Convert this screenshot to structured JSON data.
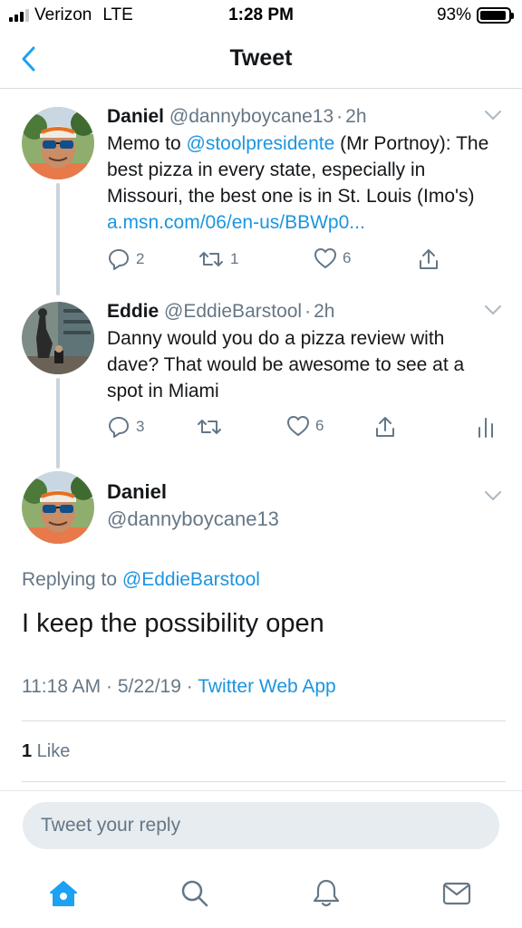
{
  "status_bar": {
    "carrier": "Verizon",
    "network": "LTE",
    "time": "1:28 PM",
    "battery_percent": "93%",
    "battery_level": 0.93
  },
  "nav": {
    "title": "Tweet",
    "back_icon": "chevron-left-icon"
  },
  "thread": [
    {
      "name": "Daniel",
      "handle": "@dannyboycane13",
      "dot": "·",
      "time": "2h",
      "text_parts": {
        "pre": "Memo to ",
        "mention": "@stoolpresidente",
        "mid": " (Mr Portnoy): The best pizza in every state, especially in Missouri, the best one is in St. Louis (Imo's) ",
        "link": "a.msn.com/06/en-us/BBWp0..."
      },
      "actions": {
        "replies": "2",
        "retweets": "1",
        "likes": "6"
      }
    },
    {
      "name": "Eddie",
      "handle": "@EddieBarstool",
      "dot": "·",
      "time": "2h",
      "text": "Danny would you do a pizza review with dave? That would be awesome to see at a spot in Miami",
      "actions": {
        "replies": "3",
        "retweets": "",
        "likes": "6"
      }
    }
  ],
  "main_tweet": {
    "name": "Daniel",
    "handle": "@dannyboycane13",
    "replying_prefix": "Replying to ",
    "replying_to": "@EddieBarstool",
    "text": "I keep the possibility open",
    "time": "11:18 AM",
    "date": "5/22/19",
    "source": "Twitter Web App",
    "sep": " · ",
    "like_count": "1",
    "like_label": " Like"
  },
  "reply": {
    "placeholder": "Tweet your reply"
  },
  "tab_bar": {
    "tabs": [
      "home-icon",
      "search-icon",
      "notifications-icon",
      "messages-icon"
    ],
    "active": "home-icon"
  },
  "colors": {
    "accent": "#1da1f2",
    "link": "#1b95e0",
    "secondary_text": "#657786",
    "divider": "#d8dde1"
  }
}
